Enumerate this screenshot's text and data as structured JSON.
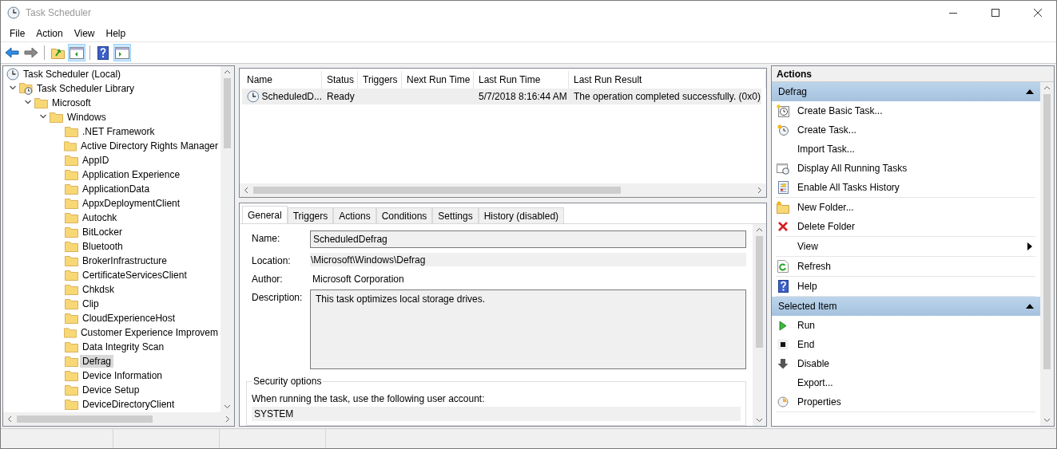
{
  "window": {
    "title": "Task Scheduler"
  },
  "menu": [
    "File",
    "Action",
    "View",
    "Help"
  ],
  "toolbar": [
    {
      "kind": "back",
      "selected": false
    },
    {
      "kind": "forward",
      "selected": false
    },
    {
      "kind": "up",
      "selected": false
    },
    {
      "kind": "console-tree",
      "selected": true
    },
    {
      "kind": "help",
      "selected": false
    },
    {
      "kind": "action-pane",
      "selected": true
    }
  ],
  "tree": {
    "root": "Task Scheduler (Local)",
    "items": [
      {
        "label": "Task Scheduler Library",
        "kind": "library",
        "expanded": true,
        "selected": false,
        "children": [
          {
            "label": "Microsoft",
            "kind": "folder",
            "expanded": true,
            "selected": false,
            "children": [
              {
                "label": "Windows",
                "kind": "folder",
                "expanded": true,
                "selected": false,
                "children": [
                  {
                    "label": ".NET Framework",
                    "kind": "folder",
                    "selected": false
                  },
                  {
                    "label": "Active Directory Rights Manager",
                    "kind": "folder",
                    "selected": false
                  },
                  {
                    "label": "AppID",
                    "kind": "folder",
                    "selected": false
                  },
                  {
                    "label": "Application Experience",
                    "kind": "folder",
                    "selected": false
                  },
                  {
                    "label": "ApplicationData",
                    "kind": "folder",
                    "selected": false
                  },
                  {
                    "label": "AppxDeploymentClient",
                    "kind": "folder",
                    "selected": false
                  },
                  {
                    "label": "Autochk",
                    "kind": "folder",
                    "selected": false
                  },
                  {
                    "label": "BitLocker",
                    "kind": "folder",
                    "selected": false
                  },
                  {
                    "label": "Bluetooth",
                    "kind": "folder",
                    "selected": false
                  },
                  {
                    "label": "BrokerInfrastructure",
                    "kind": "folder",
                    "selected": false
                  },
                  {
                    "label": "CertificateServicesClient",
                    "kind": "folder",
                    "selected": false
                  },
                  {
                    "label": "Chkdsk",
                    "kind": "folder",
                    "selected": false
                  },
                  {
                    "label": "Clip",
                    "kind": "folder",
                    "selected": false
                  },
                  {
                    "label": "CloudExperienceHost",
                    "kind": "folder",
                    "selected": false
                  },
                  {
                    "label": "Customer Experience Improvem",
                    "kind": "folder",
                    "selected": false
                  },
                  {
                    "label": "Data Integrity Scan",
                    "kind": "folder",
                    "selected": false
                  },
                  {
                    "label": "Defrag",
                    "kind": "folder",
                    "selected": true
                  },
                  {
                    "label": "Device Information",
                    "kind": "folder",
                    "selected": false
                  },
                  {
                    "label": "Device Setup",
                    "kind": "folder",
                    "selected": false
                  },
                  {
                    "label": "DeviceDirectoryClient",
                    "kind": "folder",
                    "selected": false
                  }
                ]
              }
            ]
          }
        ]
      }
    ]
  },
  "task_list": {
    "columns": [
      "Name",
      "Status",
      "Triggers",
      "Next Run Time",
      "Last Run Time",
      "Last Run Result"
    ],
    "rows": [
      {
        "cells": [
          "ScheduledD...",
          "Ready",
          "",
          "",
          "5/7/2018 8:16:44 AM",
          "The operation completed successfully. (0x0)"
        ],
        "selected": true
      }
    ]
  },
  "details": {
    "tabs": [
      {
        "label": "General",
        "selected": true
      },
      {
        "label": "Triggers",
        "selected": false
      },
      {
        "label": "Actions",
        "selected": false
      },
      {
        "label": "Conditions",
        "selected": false
      },
      {
        "label": "Settings",
        "selected": false
      },
      {
        "label": "History (disabled)",
        "selected": false
      }
    ],
    "name_label": "Name:",
    "name": "ScheduledDefrag",
    "location_label": "Location:",
    "location": "\\Microsoft\\Windows\\Defrag",
    "author_label": "Author:",
    "author": "Microsoft Corporation",
    "description_label": "Description:",
    "description": "This task optimizes local storage drives.",
    "security": {
      "title": "Security options",
      "prompt": "When running the task, use the following user account:",
      "account": "SYSTEM"
    }
  },
  "actions": {
    "title": "Actions",
    "sections": [
      {
        "title": "Defrag",
        "expanded": true,
        "groups": [
          [
            {
              "label": "Create Basic Task...",
              "kind": "basic-task"
            },
            {
              "label": "Create Task...",
              "kind": "task"
            },
            {
              "label": "Import Task...",
              "kind": "plain"
            },
            {
              "label": "Display All Running Tasks",
              "kind": "running"
            },
            {
              "label": "Enable All Tasks History",
              "kind": "history"
            }
          ],
          [
            {
              "label": "New Folder...",
              "kind": "new-folder"
            },
            {
              "label": "Delete Folder",
              "kind": "delete"
            }
          ],
          [
            {
              "label": "View",
              "kind": "plain",
              "submenu": true
            }
          ],
          [
            {
              "label": "Refresh",
              "kind": "refresh"
            }
          ],
          [
            {
              "label": "Help",
              "kind": "help"
            }
          ]
        ]
      },
      {
        "title": "Selected Item",
        "expanded": true,
        "groups": [
          [
            {
              "label": "Run",
              "kind": "run"
            },
            {
              "label": "End",
              "kind": "end"
            },
            {
              "label": "Disable",
              "kind": "disable"
            },
            {
              "label": "Export...",
              "kind": "plain"
            },
            {
              "label": "Properties",
              "kind": "properties"
            }
          ]
        ]
      }
    ]
  }
}
